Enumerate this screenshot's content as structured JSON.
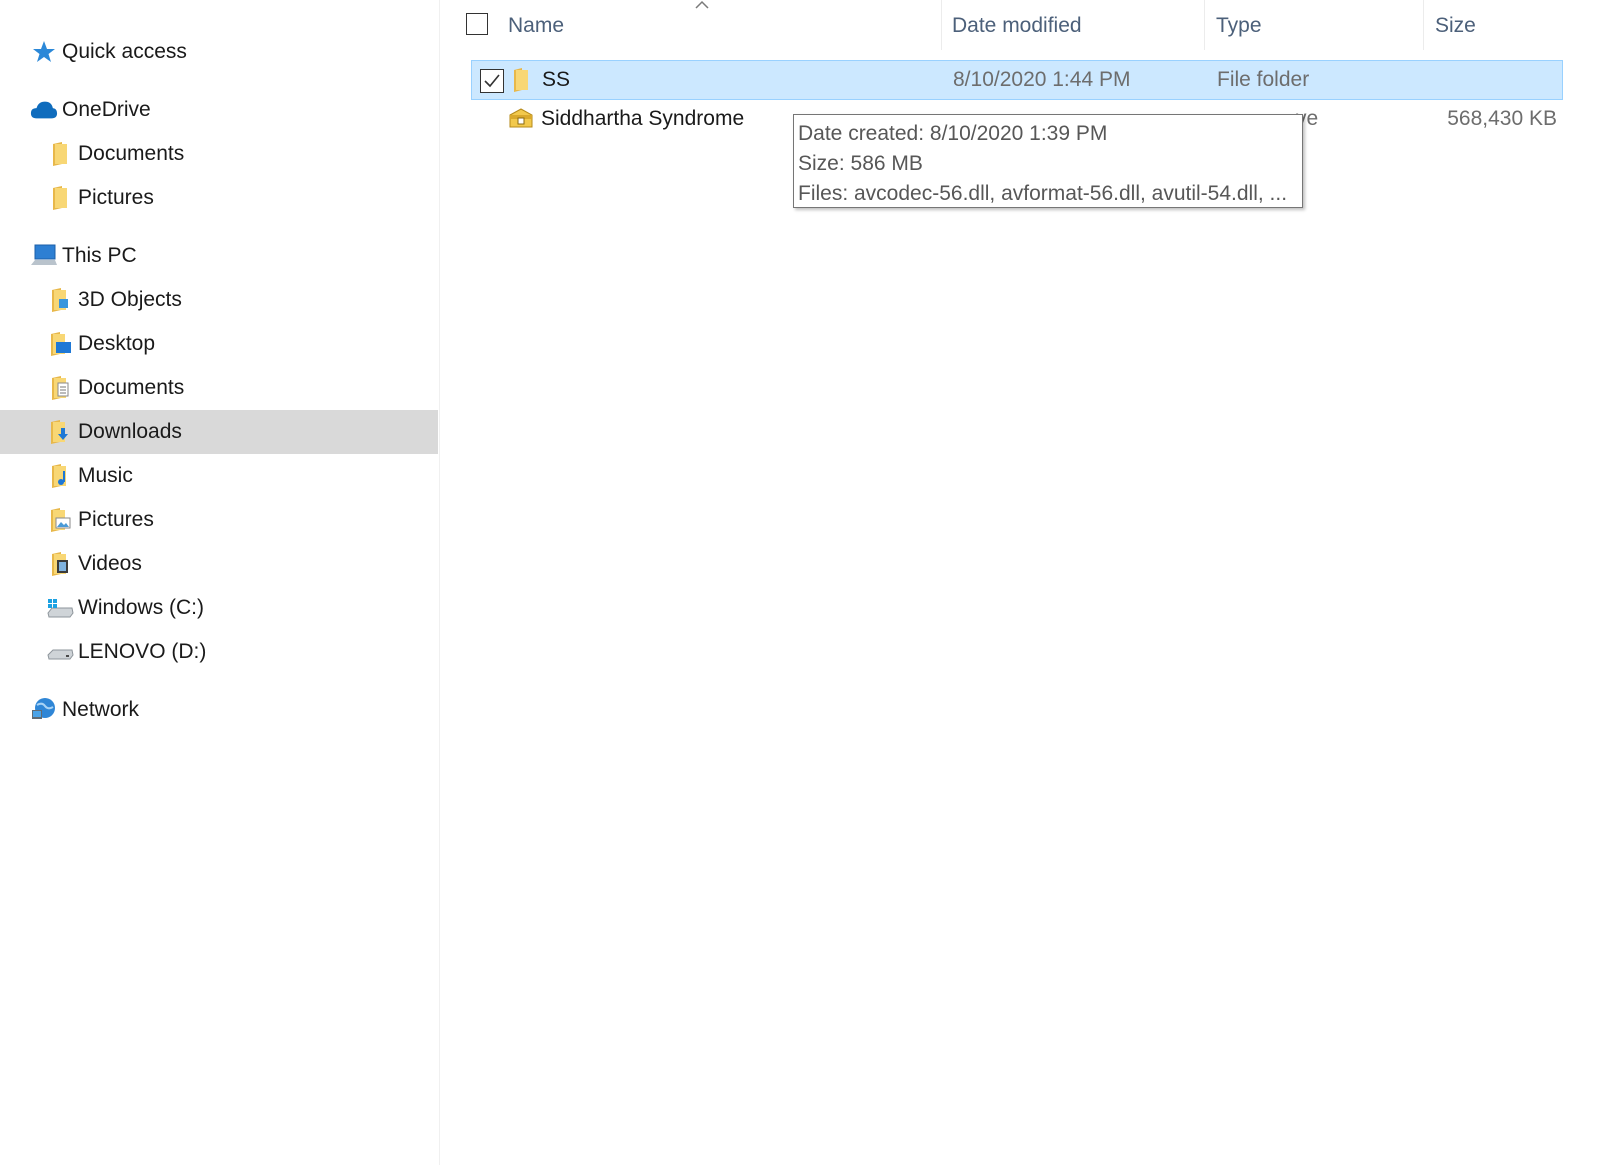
{
  "sidebar": {
    "items": [
      {
        "label": "Quick access",
        "icon": "star-icon"
      },
      {
        "label": "OneDrive",
        "icon": "cloud-icon"
      },
      {
        "label": "Documents",
        "icon": "folder-icon"
      },
      {
        "label": "Pictures",
        "icon": "folder-icon"
      },
      {
        "label": "This PC",
        "icon": "computer-icon"
      },
      {
        "label": "3D Objects",
        "icon": "3d-objects-folder-icon"
      },
      {
        "label": "Desktop",
        "icon": "desktop-folder-icon"
      },
      {
        "label": "Documents",
        "icon": "documents-folder-icon"
      },
      {
        "label": "Downloads",
        "icon": "downloads-folder-icon",
        "selected": true
      },
      {
        "label": "Music",
        "icon": "music-folder-icon"
      },
      {
        "label": "Pictures",
        "icon": "pictures-folder-icon"
      },
      {
        "label": "Videos",
        "icon": "videos-folder-icon"
      },
      {
        "label": "Windows (C:)",
        "icon": "windows-drive-icon"
      },
      {
        "label": "LENOVO (D:)",
        "icon": "drive-icon"
      },
      {
        "label": "Network",
        "icon": "network-icon"
      }
    ]
  },
  "columns": {
    "name": "Name",
    "date_modified": "Date modified",
    "type": "Type",
    "size": "Size",
    "sort": "name-ascending"
  },
  "files": [
    {
      "name": "SS",
      "date_modified": "8/10/2020 1:44 PM",
      "type": "File folder",
      "size": "",
      "selected": true,
      "checked": true,
      "icon": "folder-icon"
    },
    {
      "name": "Siddhartha Syndrome",
      "date_modified": "",
      "type": "ve",
      "size": "568,430 KB",
      "selected": false,
      "checked": false,
      "icon": "zip-archive-icon"
    }
  ],
  "tooltip": {
    "date_created": "Date created: 8/10/2020 1:39 PM",
    "size": "Size: 586 MB",
    "files": "Files: avcodec-56.dll, avformat-56.dll, avutil-54.dll, ..."
  },
  "colors": {
    "selection_bg": "#cce8ff",
    "selection_border": "#99d1ff",
    "nav_selected_bg": "#d9d9d9",
    "header_text": "#4c607a",
    "folder_yellow": "#f8d775"
  }
}
